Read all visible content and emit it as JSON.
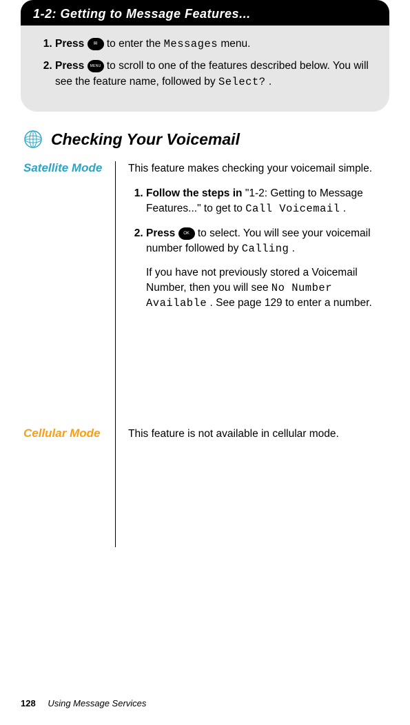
{
  "header": {
    "title": "1-2: Getting to Message Features..."
  },
  "greybox": {
    "items": [
      {
        "n": "1.",
        "lead": "Press ",
        "btn": "✉",
        "after": " to enter the ",
        "lcd": "Messages",
        "tail": " menu."
      },
      {
        "n": "2.",
        "lead": "Press ",
        "btn": "MENU",
        "after": " to scroll to one of the features described below. You will see the feature name, followed by ",
        "lcd": "Select?",
        "tail": "."
      }
    ]
  },
  "subhead": {
    "title": "Checking Your Voicemail"
  },
  "left": {
    "satTitle": "Satellite Mode",
    "cellTitle": "Cellular Mode"
  },
  "sat": {
    "intro": "This feature makes checking your voicemail simple.",
    "steps": [
      {
        "n": "1.",
        "lead": "Follow the steps in ",
        "q": "\"1-2: Getting to Message Features...\" to get to ",
        "lcd": "Call Voicemail",
        "tail": "."
      },
      {
        "n": "2.",
        "lead": "Press ",
        "btn": "OK",
        "after": "  to select. You will see your voicemail number followed by ",
        "lcd": "Calling",
        "tail": "."
      }
    ],
    "noteA": "If you have not previously stored a Voicemail Number, then you will see ",
    "noteLcd": "No Number Available",
    "noteB": ". See page 129 to enter a number."
  },
  "cell": {
    "text": "This feature is not available in cellular mode."
  },
  "footer": {
    "page": "128",
    "title": "Using Message Services"
  }
}
